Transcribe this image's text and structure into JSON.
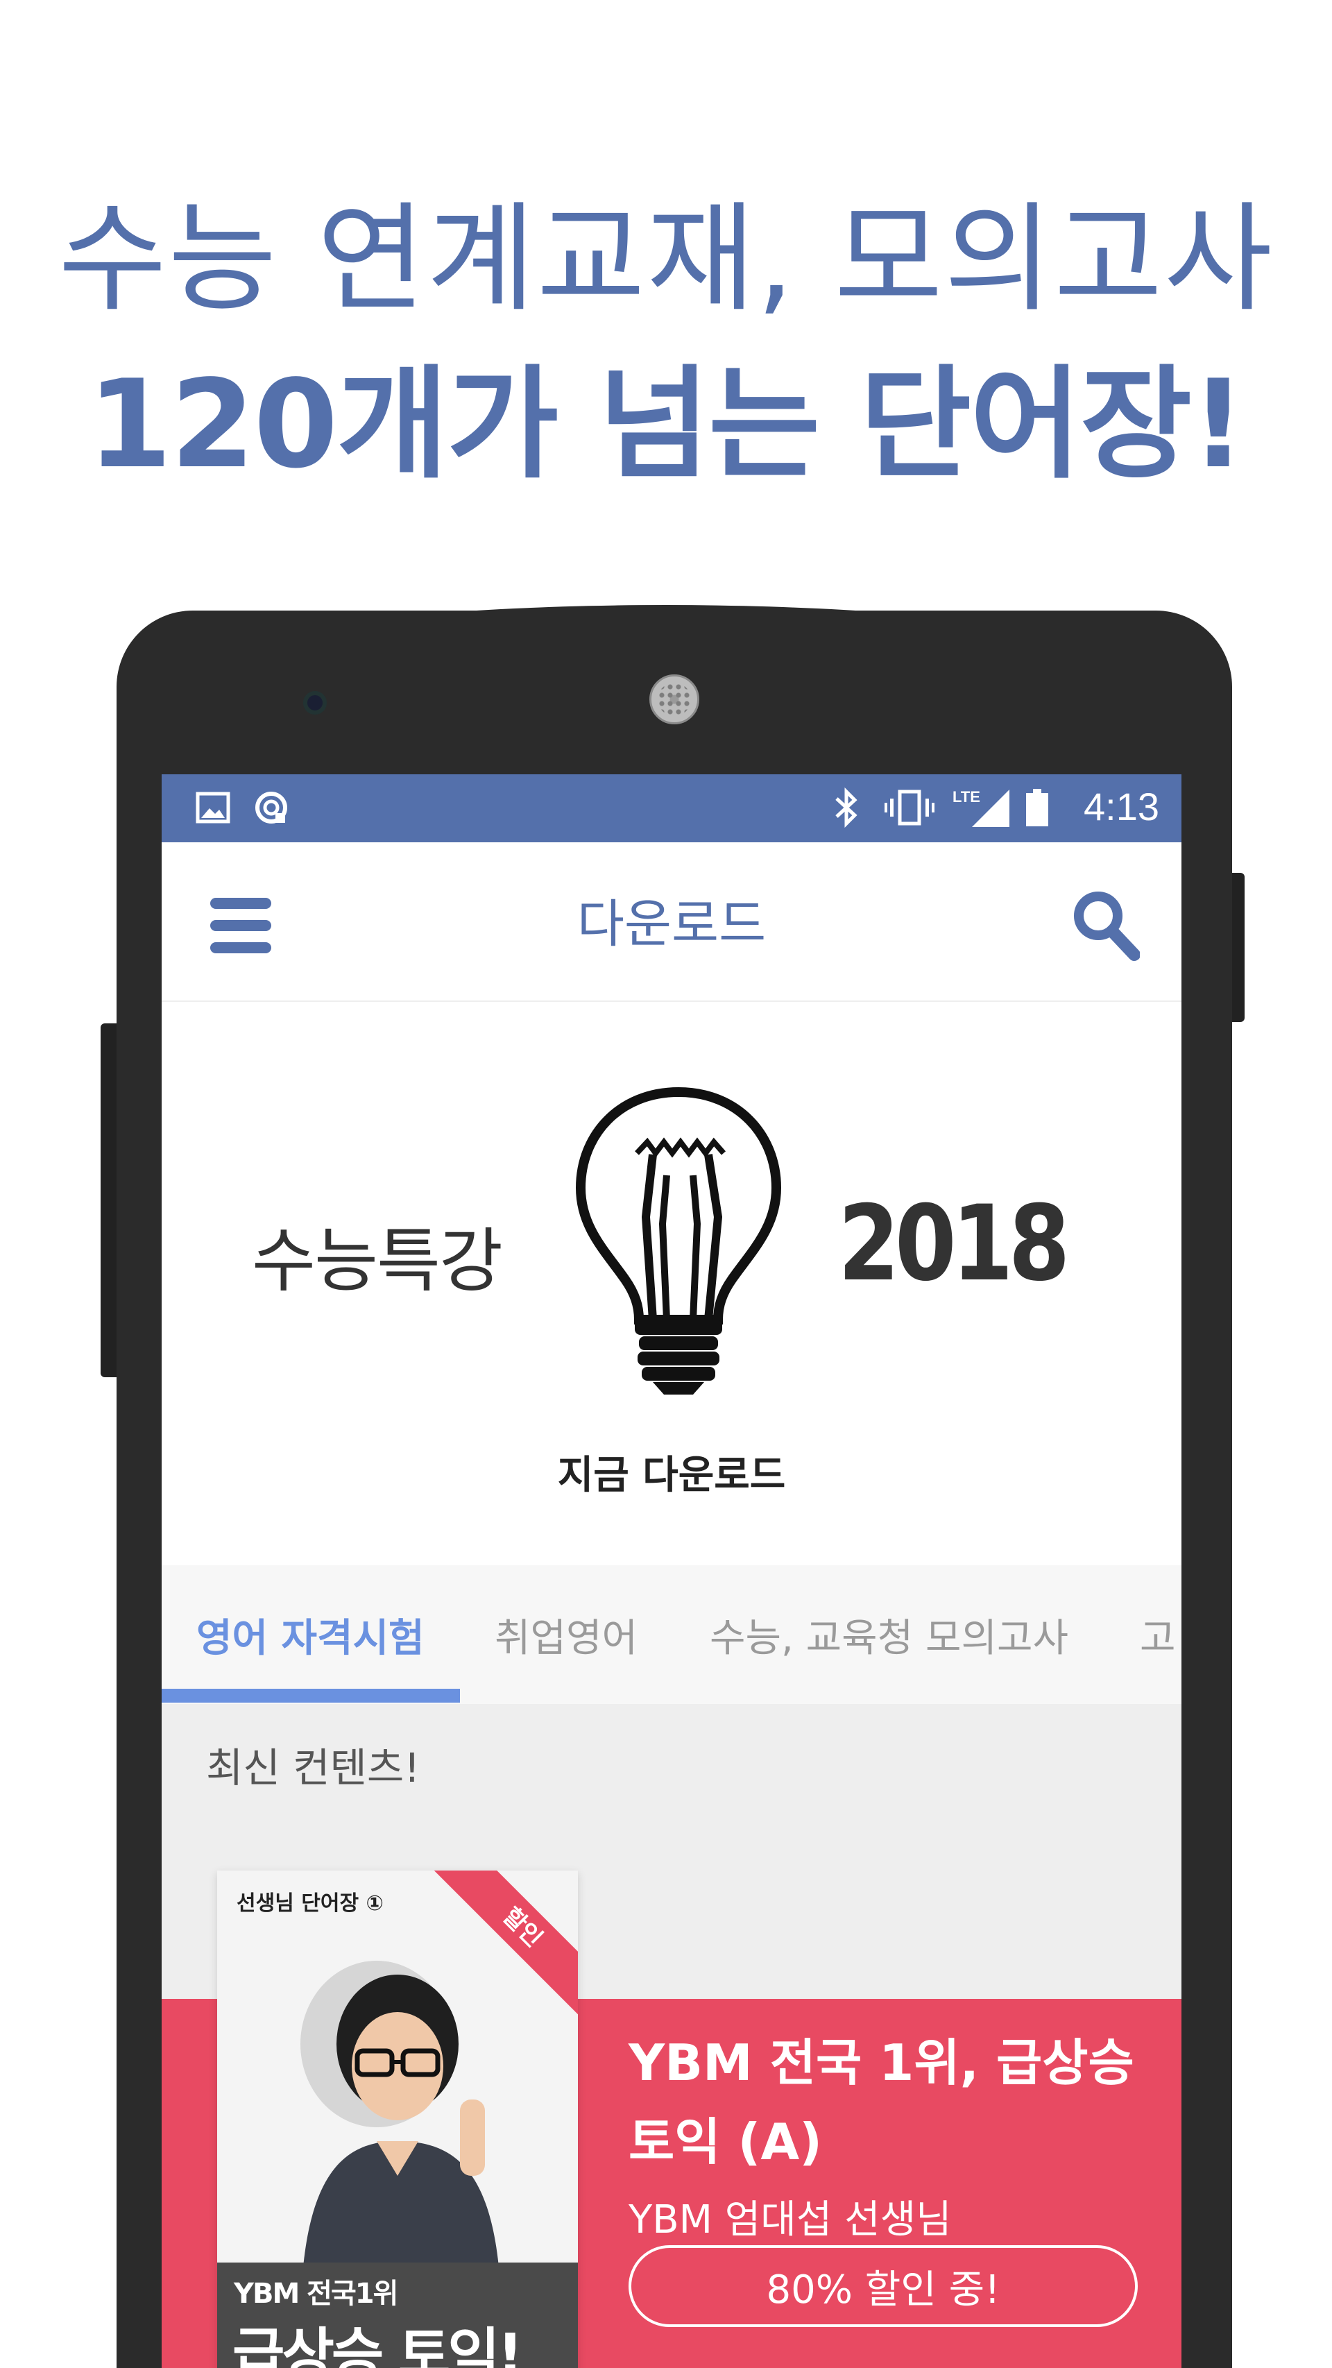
{
  "headline": {
    "line1": "수능 연계교재, 모의고사",
    "line2": "120개가 넘는 단어장!"
  },
  "statusbar": {
    "time": "4:13",
    "lte": "LTE",
    "icons": [
      "image-icon",
      "sync-icon",
      "bluetooth-icon",
      "vibrate-icon",
      "signal-icon",
      "battery-icon"
    ]
  },
  "appbar": {
    "title": "다운로드",
    "menu_icon": "hamburger-menu-icon",
    "search_icon": "search-icon"
  },
  "banner": {
    "left_text": "수능특강",
    "right_text": "2018",
    "cta": "지금 다운로드",
    "icon": "lightbulb-icon"
  },
  "tabs": [
    {
      "label": "영어 자격시험",
      "active": true
    },
    {
      "label": "취업영어",
      "active": false
    },
    {
      "label": "수능, 교육청 모의고사",
      "active": false
    },
    {
      "label": "고",
      "active": false
    }
  ],
  "section": {
    "title": "최신 컨텐츠!"
  },
  "promo": {
    "book_label": "선생님 단어장 ①",
    "book_ribbon": "할인",
    "book_footer_line1": "YBM 전국1위",
    "book_footer_line2": "급상승 토익!",
    "title": "YBM 전국 1위, 급상승 토익 (A)",
    "teacher": "YBM 엄대섭 선생님",
    "button": "80% 할인 중!"
  },
  "colors": {
    "brand_blue": "#5470ab",
    "tab_active": "#6a91e0",
    "promo_red": "#e84a62",
    "phone_body": "#2b2b2b"
  }
}
